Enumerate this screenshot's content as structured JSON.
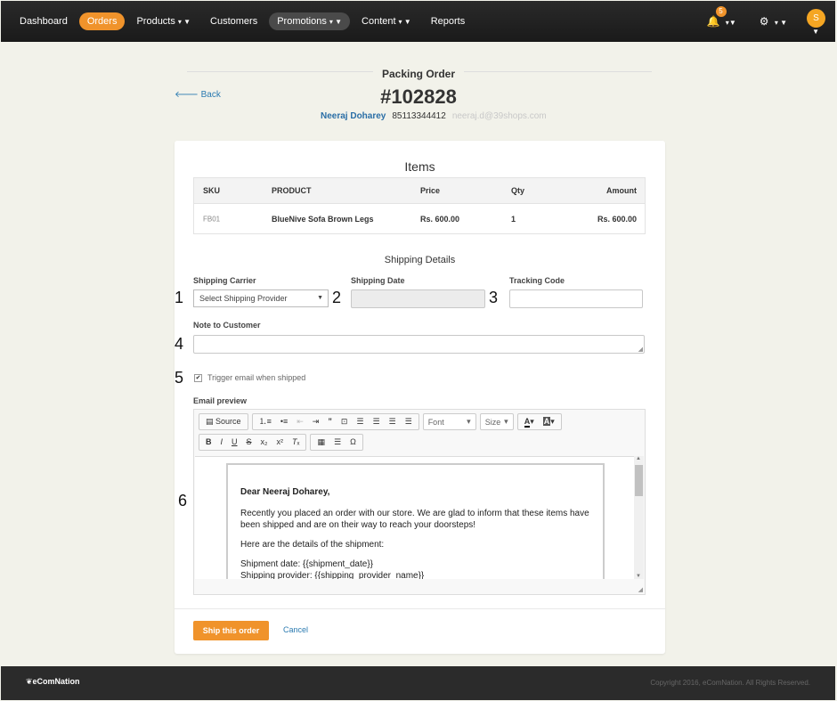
{
  "nav": {
    "items": [
      {
        "label": "Dashboard",
        "caret": false
      },
      {
        "label": "Orders",
        "caret": false
      },
      {
        "label": "Products",
        "caret": true
      },
      {
        "label": "Customers",
        "caret": false
      },
      {
        "label": "Promotions",
        "caret": true
      },
      {
        "label": "Content",
        "caret": true
      },
      {
        "label": "Reports",
        "caret": false
      }
    ],
    "notification_count": "5",
    "avatar_letter": "S"
  },
  "header": {
    "title": "Packing Order",
    "back": "Back",
    "order_number": "#102828",
    "customer_name": "Neeraj Doharey",
    "customer_phone": "85113344412",
    "customer_email": "neeraj.d@39shops.com"
  },
  "items": {
    "title": "Items",
    "columns": [
      "SKU",
      "PRODUCT",
      "Price",
      "Qty",
      "Amount"
    ],
    "rows": [
      {
        "sku": "FB01",
        "product": "BlueNive Sofa Brown Legs",
        "price": "Rs. 600.00",
        "qty": "1",
        "amount": "Rs. 600.00"
      }
    ]
  },
  "shipping": {
    "title": "Shipping Details",
    "carrier_label": "Shipping Carrier",
    "carrier_value": "Select Shipping Provider",
    "date_label": "Shipping Date",
    "tracking_label": "Tracking Code",
    "note_label": "Note to Customer",
    "trigger_label": "Trigger email when shipped",
    "trigger_checked": true,
    "email_preview_label": "Email preview"
  },
  "editor": {
    "source": "Source",
    "font": "Font",
    "size": "Size",
    "greeting": "Dear Neeraj Doharey,",
    "para1": "Recently you placed an order with our store. We are glad to inform that these items have been shipped and are on their way to reach your doorsteps!",
    "para2": "Here are the details of the shipment:",
    "line_date": "Shipment date: {{shipment_date}}",
    "line_provider": "Shipping provider: {{shipping_provider_name}}"
  },
  "actions": {
    "ship": "Ship this order",
    "cancel": "Cancel"
  },
  "annotations": [
    "1",
    "2",
    "3",
    "4",
    "5",
    "6"
  ],
  "footer": {
    "logo": "eComNation",
    "copyright": "Copyright 2016, eComNation. All Rights Reserved."
  },
  "colors": {
    "accent": "#f0932b",
    "link": "#2a7ab0",
    "nav_bg": "#1f1f1f",
    "page_bg": "#f2f2ea"
  }
}
